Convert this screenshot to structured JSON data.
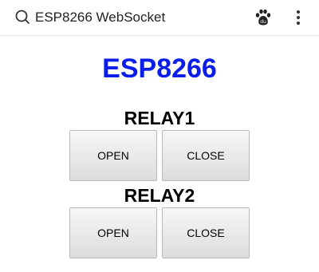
{
  "browser": {
    "title": "ESP8266 WebSocket",
    "search_icon": "search-icon",
    "paw_icon": "paw-icon",
    "more_icon": "more-vertical-icon"
  },
  "page": {
    "heading": "ESP8266",
    "heading_color": "#0b1de8"
  },
  "relays": [
    {
      "label": "RELAY1",
      "open_label": "OPEN",
      "close_label": "CLOSE"
    },
    {
      "label": "RELAY2",
      "open_label": "OPEN",
      "close_label": "CLOSE"
    }
  ]
}
